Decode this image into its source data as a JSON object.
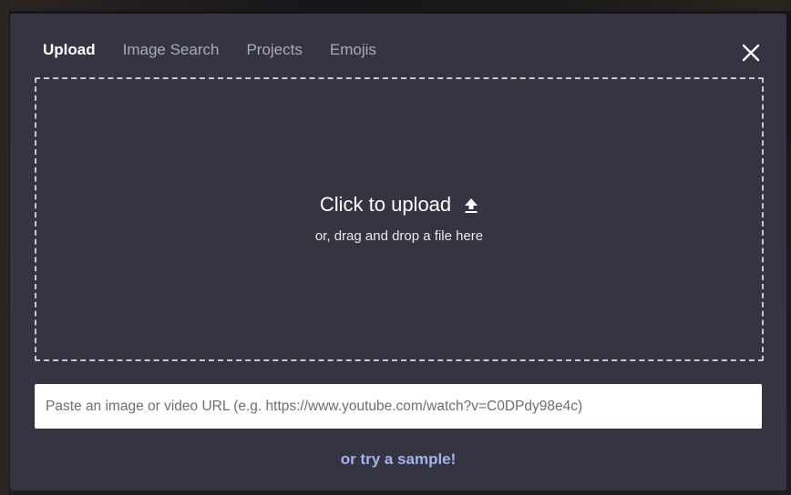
{
  "tabs": [
    {
      "label": "Upload",
      "active": true
    },
    {
      "label": "Image Search",
      "active": false
    },
    {
      "label": "Projects",
      "active": false
    },
    {
      "label": "Emojis",
      "active": false
    }
  ],
  "close": {
    "icon": "close-icon"
  },
  "dropzone": {
    "title": "Click to upload",
    "title_icon": "upload-arrow-icon",
    "subtitle": "or, drag and drop a file here"
  },
  "url_input": {
    "value": "",
    "placeholder": "Paste an image or video URL (e.g. https://www.youtube.com/watch?v=C0DPdy98e4c)"
  },
  "sample_link": {
    "label": "or try a sample!"
  },
  "colors": {
    "modal_bg": "#343540",
    "accent_link": "#a4b2f0",
    "inactive_tab": "#a9abb6"
  }
}
